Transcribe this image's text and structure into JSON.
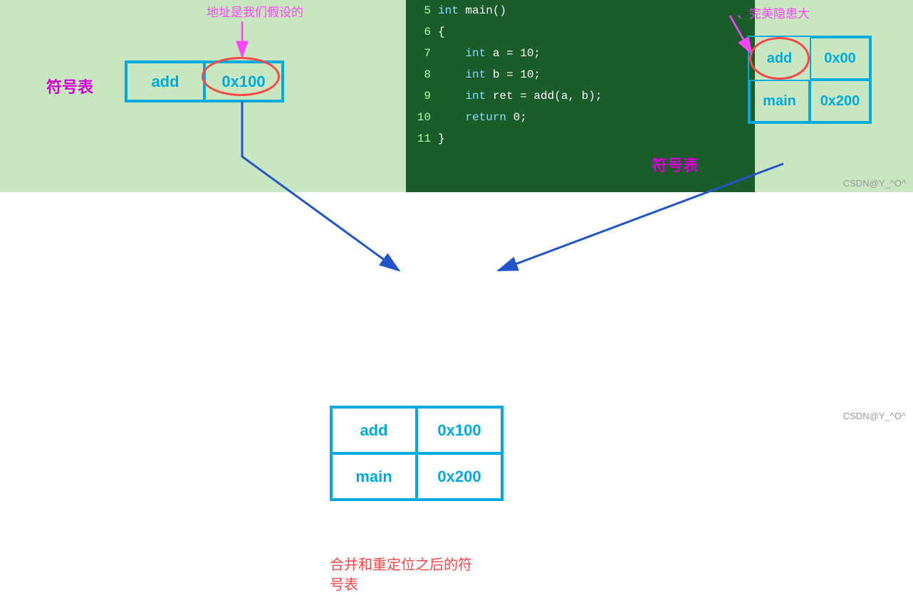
{
  "top": {
    "symbol_table_label_left": "符号表",
    "symbol_table_label_right": "符号表",
    "address_annotation": "地址是我们假设的",
    "right_annotation": "、完美隐患大",
    "top_table": {
      "cells": [
        "add",
        "0x100"
      ]
    },
    "right_table": {
      "rows": [
        [
          "add",
          "0x00"
        ],
        [
          "main",
          "0x200"
        ]
      ]
    },
    "watermark": "CSDN@Y_^O^"
  },
  "code": {
    "lines": [
      {
        "num": "5",
        "content": "int main()"
      },
      {
        "num": "6",
        "content": "{"
      },
      {
        "num": "7",
        "content": "    int a = 10;"
      },
      {
        "num": "8",
        "content": "    int b = 10;"
      },
      {
        "num": "9",
        "content": "    int ret = add(a, b);"
      },
      {
        "num": "10",
        "content": "    return 0;"
      },
      {
        "num": "11",
        "content": "}"
      }
    ]
  },
  "bottom": {
    "table": {
      "rows": [
        [
          "add",
          "0x100"
        ],
        [
          "main",
          "0x200"
        ]
      ]
    },
    "label": "合并和重定位之后的符\n号表",
    "watermark": "CSDN@Y_^O^"
  }
}
